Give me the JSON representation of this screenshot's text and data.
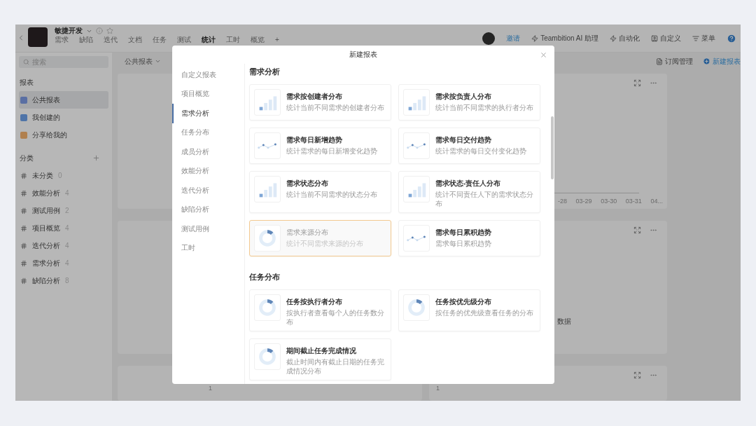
{
  "app": {
    "project_name": "敏捷开发",
    "nav_tabs": [
      {
        "label": "需求",
        "selected": false
      },
      {
        "label": "缺陷",
        "selected": false
      },
      {
        "label": "迭代",
        "selected": false
      },
      {
        "label": "文档",
        "selected": false
      },
      {
        "label": "任务",
        "selected": false
      },
      {
        "label": "测试",
        "selected": false
      },
      {
        "label": "统计",
        "selected": true
      },
      {
        "label": "工时",
        "selected": false
      },
      {
        "label": "概览",
        "selected": false
      }
    ],
    "add_tab": "+",
    "actions": {
      "invite": "邀请",
      "ai_assistant": "Teambition AI 助理",
      "automation": "自动化",
      "customize": "自定义",
      "menu": "菜单"
    }
  },
  "toolbar": {
    "search": {
      "placeholder": "搜索"
    },
    "scope": "公共报表",
    "subscribe": "订阅管理",
    "new_report": "新建报表"
  },
  "sidebar": {
    "reports_title": "报表",
    "items": [
      {
        "label": "公共报表",
        "selected": true,
        "color": "#5a6fa3"
      },
      {
        "label": "我创建的",
        "selected": false,
        "color": "#4f74a8"
      },
      {
        "label": "分享给我的",
        "selected": false,
        "color": "#b0804f"
      }
    ],
    "categories_title": "分类",
    "categories": [
      {
        "label": "未分类",
        "count": "0"
      },
      {
        "label": "效能分析",
        "count": "4"
      },
      {
        "label": "测试用例",
        "count": "2"
      },
      {
        "label": "项目概览",
        "count": "4"
      },
      {
        "label": "迭代分析",
        "count": "4"
      },
      {
        "label": "需求分析",
        "count": "4"
      },
      {
        "label": "缺陷分析",
        "count": "8"
      }
    ]
  },
  "report_cards": [
    {
      "kind": "blank"
    },
    {
      "kind": "axis",
      "axis_labels": [
        "-28",
        "03-29",
        "03-30",
        "03-31",
        "04..."
      ]
    },
    {
      "kind": "blank"
    },
    {
      "kind": "empty",
      "message": "数据"
    },
    {
      "kind": "count",
      "value": "1"
    },
    {
      "kind": "count",
      "value": "1"
    }
  ],
  "dialog": {
    "title": "新建报表",
    "nav": [
      {
        "label": "自定义报表",
        "selected": false
      },
      {
        "label": "项目概览",
        "selected": false
      },
      {
        "label": "需求分析",
        "selected": true
      },
      {
        "label": "任务分布",
        "selected": false
      },
      {
        "label": "成员分析",
        "selected": false
      },
      {
        "label": "效能分析",
        "selected": false
      },
      {
        "label": "迭代分析",
        "selected": false
      },
      {
        "label": "缺陷分析",
        "selected": false
      },
      {
        "label": "测试用例",
        "selected": false
      },
      {
        "label": "工时",
        "selected": false
      }
    ],
    "sections": [
      {
        "title": "需求分析",
        "reports": [
          {
            "kind": "bar",
            "title": "需求按创建者分布",
            "description": "统计当前不同需求的创建者分布",
            "selected": false
          },
          {
            "kind": "bar",
            "title": "需求按负责人分布",
            "description": "统计当前不同需求的执行者分布",
            "selected": false
          },
          {
            "kind": "line",
            "title": "需求每日新增趋势",
            "description": "统计需求的每日新增变化趋势",
            "selected": false
          },
          {
            "kind": "line",
            "title": "需求每日交付趋势",
            "description": "统计需求的每日交付变化趋势",
            "selected": false
          },
          {
            "kind": "bar",
            "title": "需求状态分布",
            "description": "统计当前不同需求的状态分布",
            "selected": false
          },
          {
            "kind": "bar",
            "title": "需求状态-责任人分布",
            "description": "统计不同责任人下的需求状态分布",
            "selected": false
          },
          {
            "kind": "donut",
            "title": "需求来源分布",
            "description": "统计不同需求来源的分布",
            "selected": true
          },
          {
            "kind": "line",
            "title": "需求每日累积趋势",
            "description": "需求每日累积趋势",
            "selected": false
          }
        ]
      },
      {
        "title": "任务分布",
        "reports": [
          {
            "kind": "donut",
            "title": "任务按执行者分布",
            "description": "按执行者查看每个人的任务数分布",
            "selected": false
          },
          {
            "kind": "donut",
            "title": "任务按优先级分布",
            "description": "按任务的优先级查看任务的分布",
            "selected": false
          },
          {
            "kind": "donut",
            "title": "期间截止任务完成情况",
            "description": "截止时间内有截止日期的任务完成情况分布",
            "selected": false
          }
        ]
      }
    ]
  }
}
